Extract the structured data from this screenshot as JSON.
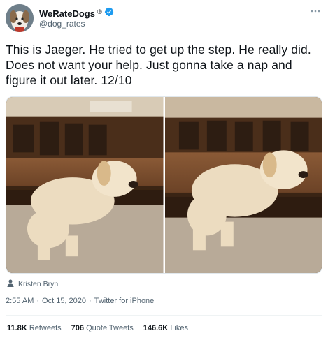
{
  "user": {
    "display_name": "WeRateDogs",
    "registered_mark": "®",
    "handle": "@dog_rates"
  },
  "tweet": {
    "text": "This is Jaeger. He tried to get up the step. He really did. Does not want your help. Just gonna take a nap and figure it out later. 12/10"
  },
  "media": {
    "photos": [
      "puppy-napping-on-step-1",
      "puppy-napping-on-step-2"
    ],
    "credit": "Kristen Bryn"
  },
  "meta": {
    "time": "2:55 AM",
    "date": "Oct 15, 2020",
    "source": "Twitter for iPhone",
    "separator": "·"
  },
  "stats": {
    "retweets_count": "11.8K",
    "retweets_label": "Retweets",
    "quotes_count": "706",
    "quotes_label": "Quote Tweets",
    "likes_count": "146.6K",
    "likes_label": "Likes"
  },
  "colors": {
    "verified": "#1d9bf0",
    "secondary_text": "#536471",
    "primary_text": "#0f1419"
  },
  "icons": [
    "verified-badge-icon",
    "more-options-icon",
    "person-icon"
  ]
}
